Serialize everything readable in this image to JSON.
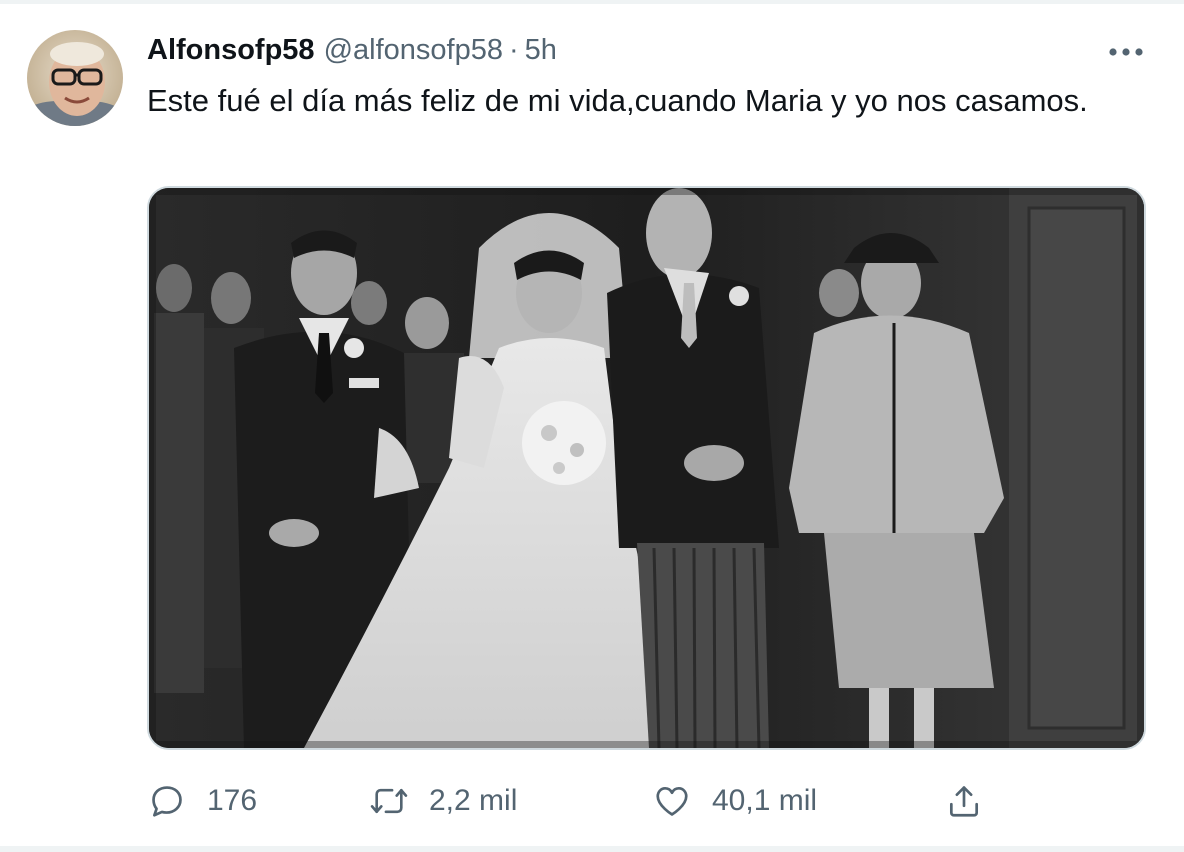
{
  "tweet": {
    "display_name": "Alfonsofp58",
    "handle": "@alfonsofp58",
    "separator": "·",
    "time": "5h",
    "text": "Este fué el día más feliz de mi vida,cuando Maria y yo nos casamos."
  },
  "actions": {
    "replies": "176",
    "retweets": "2,2 mil",
    "likes": "40,1 mil"
  },
  "icons": {
    "more": "more-icon",
    "reply": "reply-icon",
    "retweet": "retweet-icon",
    "like": "heart-icon",
    "share": "share-icon"
  },
  "colors": {
    "primary_text": "#0f1419",
    "secondary_text": "#536471",
    "border": "#cfd9de"
  }
}
